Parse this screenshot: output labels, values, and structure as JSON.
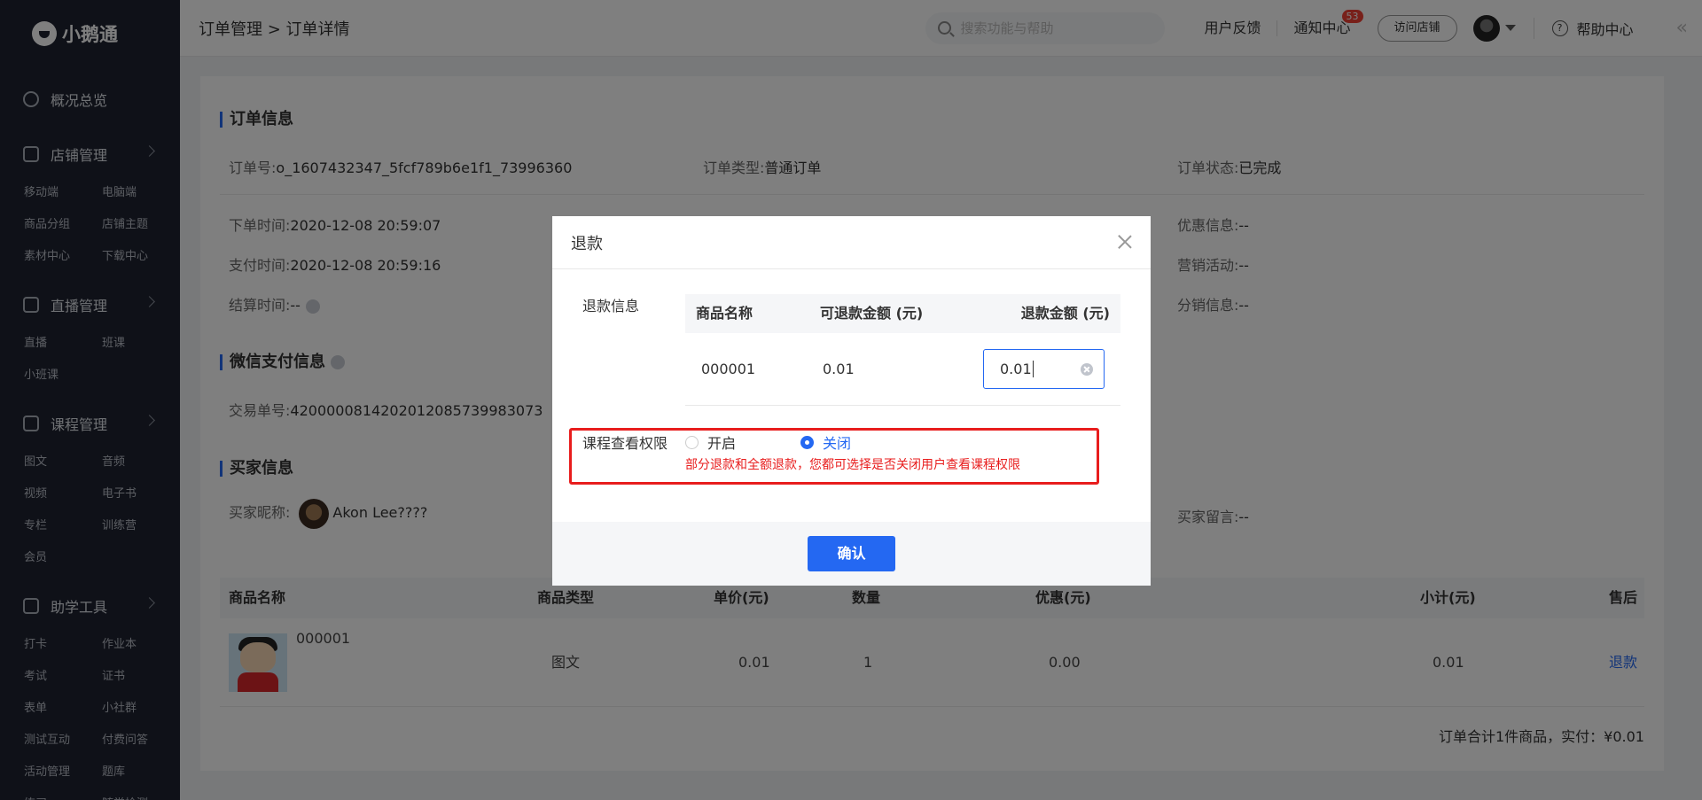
{
  "sidebar": {
    "logo": "小鹅通",
    "groups": [
      {
        "title": "概况总览",
        "items": []
      },
      {
        "title": "店铺管理",
        "items": [
          "移动端",
          "电脑端",
          "商品分组",
          "店铺主题",
          "素材中心",
          "下载中心"
        ]
      },
      {
        "title": "直播管理",
        "items": [
          "直播",
          "班课",
          "小班课"
        ]
      },
      {
        "title": "课程管理",
        "items": [
          "图文",
          "音频",
          "视频",
          "电子书",
          "专栏",
          "训练营",
          "会员"
        ]
      },
      {
        "title": "助学工具",
        "items": [
          "打卡",
          "作业本",
          "考试",
          "证书",
          "表单",
          "小社群",
          "测试互动",
          "付费问答",
          "活动管理",
          "题库",
          "练习",
          "随堂检测"
        ]
      }
    ]
  },
  "topbar": {
    "breadcrumb": "订单管理 > 订单详情",
    "search_placeholder": "搜索功能与帮助",
    "feedback": "用户反馈",
    "notify": "通知中心",
    "notify_count": "53",
    "visit_shop": "访问店铺",
    "help": "帮助中心"
  },
  "order": {
    "title": "订单信息",
    "order_no_label": "订单号:",
    "order_no": "o_1607432347_5fcf789b6e1f1_73996360",
    "type_label": "订单类型:",
    "type": "普通订单",
    "status_label": "订单状态:",
    "status": "已完成",
    "order_time_label": "下单时间:",
    "order_time": "2020-12-08 20:59:07",
    "pay_time_label": "支付时间:",
    "pay_time": "2020-12-08 20:59:16",
    "settle_label": "结算时间:",
    "settle": "--",
    "discount_label": "优惠信息:",
    "discount": "--",
    "marketing_label": "营销活动:",
    "marketing": "--",
    "distribution_label": "分销信息:",
    "distribution": "--"
  },
  "wechat": {
    "title": "微信支付信息",
    "trade_no_label": "交易单号:",
    "trade_no": "4200000814202012085739983073"
  },
  "buyer": {
    "title": "买家信息",
    "nick_label": "买家昵称:",
    "nick": "Akon Lee????",
    "msg_label": "买家留言:",
    "msg": "--"
  },
  "goods_table": {
    "headers": [
      "商品名称",
      "商品类型",
      "单价(元)",
      "数量",
      "优惠(元)",
      "小计(元)",
      "售后"
    ],
    "row": {
      "name": "000001",
      "type": "图文",
      "price": "0.01",
      "qty": "1",
      "discount": "0.00",
      "subtotal": "0.01",
      "action": "退款"
    },
    "total": "订单合计1件商品，实付：¥0.01"
  },
  "modal": {
    "title": "退款",
    "refund_info_label": "退款信息",
    "headers": [
      "商品名称",
      "可退款金额 (元)",
      "退款金额 (元)"
    ],
    "row": {
      "name": "000001",
      "refundable": "0.01",
      "amount": "0.01"
    },
    "permission_label": "课程查看权限",
    "option_on": "开启",
    "option_off": "关闭",
    "selected": "关闭",
    "warning": "部分退款和全额退款，您都可选择是否关闭用户查看课程权限",
    "confirm": "确认"
  },
  "colors": {
    "accent": "#2468f2",
    "warning": "#e81d1d",
    "sidebar_bg": "#1e2330"
  }
}
